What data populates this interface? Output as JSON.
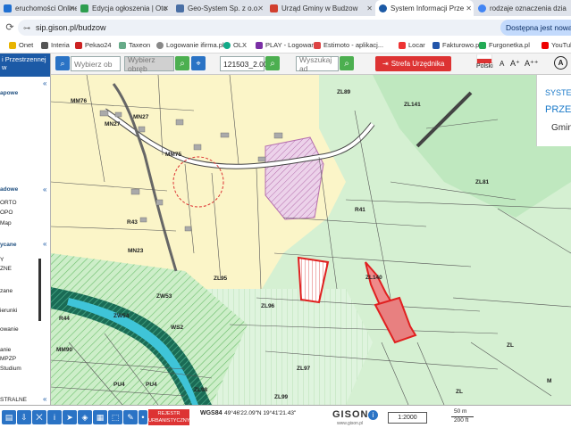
{
  "tabs": [
    {
      "label": "eruchomości Online -",
      "active": false,
      "color": "#1f6fd1"
    },
    {
      "label": "Edycja ogłoszenia | Oto",
      "active": false,
      "color": "#2e9e4f"
    },
    {
      "label": "Geo-System Sp. z o.o.",
      "active": false,
      "color": "#4a6fa5"
    },
    {
      "label": "Urząd Gminy w Budzow",
      "active": false,
      "color": "#d13f2e"
    },
    {
      "label": "System Informacji Prze",
      "active": true,
      "color": "#1c5aa6"
    },
    {
      "label": "rodzaje oznaczenia dzia",
      "active": false,
      "color": "#4285f4"
    }
  ],
  "address": {
    "url": "sip.gison.pl/budzow",
    "availability": "Dostępna jest nowa"
  },
  "bookmarks": [
    "Onet",
    "Interia",
    "Pekao24",
    "Taxeon",
    "Logowanie ifirma.pl",
    "OLX",
    "PLAY - Logowanie",
    "Estimoto - aplikacj...",
    "Locar",
    "Fakturowo.pl",
    "Furgonetka.pl",
    "YouTub"
  ],
  "toolbar": {
    "obiekt_placeholder": "Wybierz ob",
    "obreb_placeholder": "Wybierz obręb",
    "coord_value": "121503_2.00",
    "search_placeholder": "Wyszukaj ad",
    "strefa_label": "Strefa Urzędnika",
    "language": "Polski",
    "font_small": "A",
    "font_med": "A⁺",
    "font_large": "A⁺⁺"
  },
  "sidebar": {
    "header": "i Przestrzennej",
    "sub": "w",
    "items": [
      "apowe",
      "adowe",
      "ORTO",
      "OPO",
      "Map",
      "ycane",
      "Y",
      "ZNE",
      "zane",
      "ierunki",
      "owanie",
      "anie",
      "MPZP",
      "Studium",
      "STRALNE"
    ]
  },
  "right_panel": {
    "line1": "SYSTEM",
    "line2": "PRZES",
    "line3": "Gmin"
  },
  "map_labels": [
    "MM76",
    "MN27",
    "MN27",
    "MM75",
    "MN23",
    "R43",
    "ZL95",
    "ZL96",
    "R44",
    "MM90",
    "PU4",
    "PU4",
    "ZL98",
    "ZW53",
    "ZW54",
    "WS2",
    "ZL89",
    "ZL141",
    "ZL81",
    "R41",
    "ZL140",
    "ZL97",
    "ZL99",
    "ZL",
    "ZL",
    "M"
  ],
  "bottom": {
    "red_button": "REJESTR URBANISTYCZNY",
    "coords_label": "WGS84",
    "coords_value": "49°46'22.09\"N 19°41'21.43\"",
    "brand": "GISON",
    "brand_url": "www.gison.pl",
    "scale_ratio": "1:2000",
    "scale_m": "50 m",
    "scale_ft": "200 ft"
  },
  "colors": {
    "accent": "#1c5aa6",
    "red": "#d33333",
    "green": "#4caf50",
    "map_yellow": "#fdfde0",
    "map_green": "#cfefcf"
  }
}
